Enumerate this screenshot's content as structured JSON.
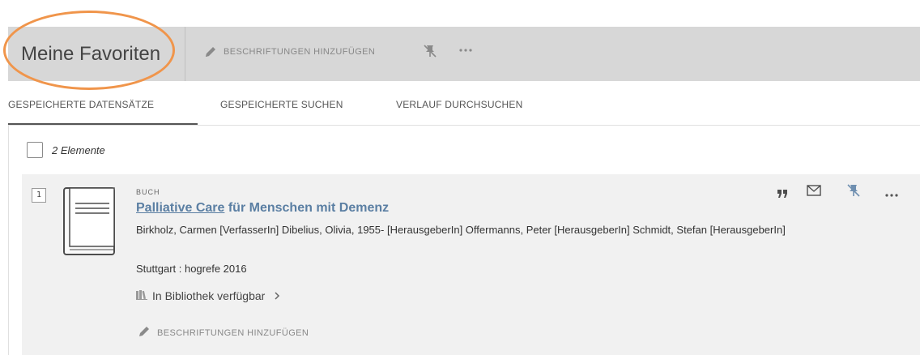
{
  "header": {
    "title": "Meine Favoriten",
    "add_labels": "BESCHRIFTUNGEN HINZUFÜGEN"
  },
  "tabs": [
    {
      "label": "GESPEICHERTE DATENSÄTZE",
      "active": true
    },
    {
      "label": "GESPEICHERTE SUCHEN",
      "active": false
    },
    {
      "label": "VERLAUF DURCHSUCHEN",
      "active": false
    }
  ],
  "list": {
    "count_label": "2 Elemente"
  },
  "result": {
    "number": "1",
    "type": "BUCH",
    "title_highlight": "Palliative Care",
    "title_rest": " für Menschen mit Demenz",
    "authors": "Birkholz, Carmen [VerfasserIn] Dibelius, Olivia, 1955- [HerausgeberIn] Offermanns, Peter [HerausgeberIn] Schmidt, Stefan [HerausgeberIn]",
    "publication": "Stuttgart : hogrefe 2016",
    "availability": "In Bibliothek verfügbar",
    "add_labels": "BESCHRIFTUNGEN HINZUFÜGEN"
  },
  "colors": {
    "header_bg": "#d7d7d7",
    "card_bg": "#f1f1f1",
    "link": "#5b7fa3",
    "pin_accent": "#6f8fb0",
    "annotation_ellipse": "#f0954b"
  },
  "icons": {
    "header": [
      "pencil-icon",
      "unpin-icon",
      "more-icon"
    ],
    "card": [
      "citation-icon",
      "email-icon",
      "unpin-icon",
      "more-icon",
      "book-icon",
      "library-icon",
      "chevron-right-icon",
      "pencil-icon"
    ]
  }
}
